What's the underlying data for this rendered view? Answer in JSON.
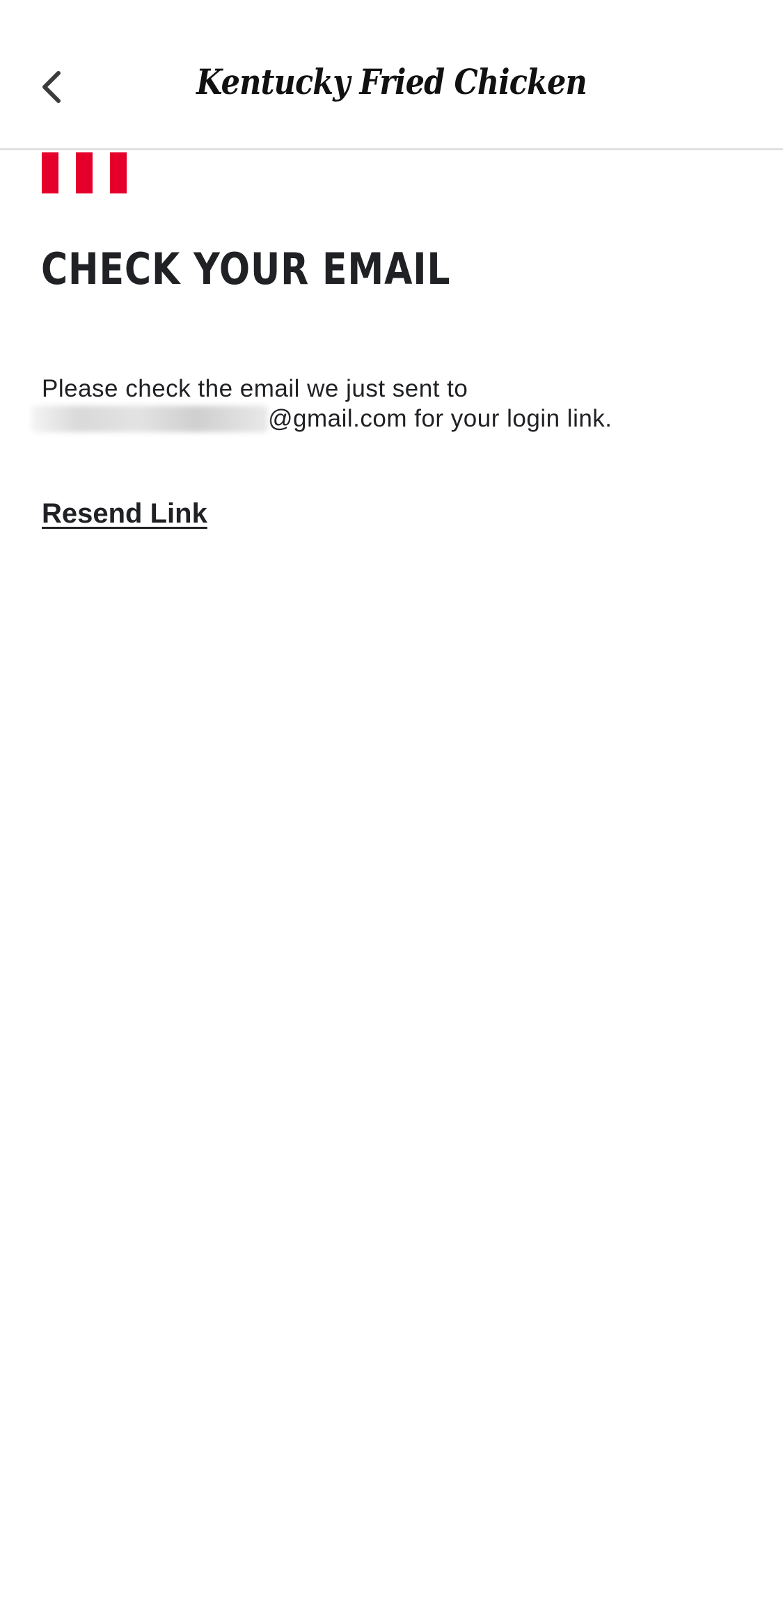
{
  "header": {
    "back_icon": "chevron-left-icon",
    "brand": "Kentucky Fried Chicken"
  },
  "accent": {
    "stripe_color": "#e4002b",
    "stripe_count": 3
  },
  "main": {
    "title": "CHECK YOUR EMAIL",
    "message_line1": "Please check the email we just sent to",
    "message_email_suffix": "@gmail.com for your login link.",
    "resend_label": "Resend Link"
  }
}
